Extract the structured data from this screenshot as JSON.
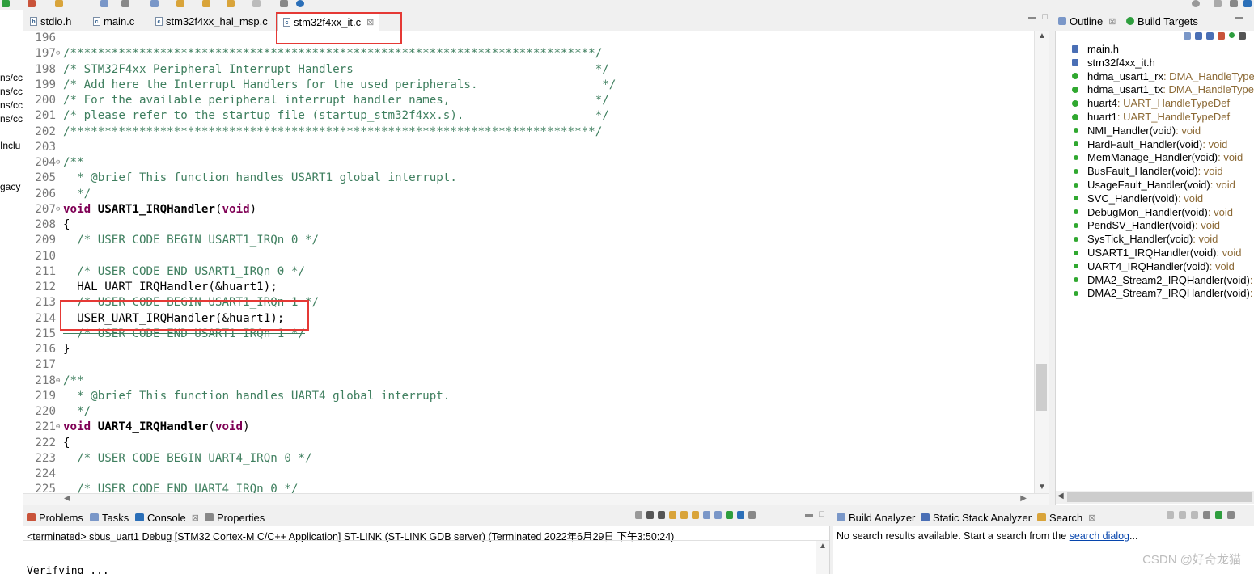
{
  "editor": {
    "tabs": [
      {
        "label": "stdio.h",
        "icon": "header-file-icon",
        "active": false
      },
      {
        "label": "main.c",
        "icon": "c-file-icon",
        "active": false
      },
      {
        "label": "stm32f4xx_hal_msp.c",
        "icon": "c-file-icon",
        "active": false
      },
      {
        "label": "stm32f4xx_it.c",
        "icon": "c-file-icon",
        "active": true
      }
    ],
    "close_glyph": "⊠",
    "lines": [
      {
        "num": "196",
        "segments": []
      },
      {
        "num": "197",
        "fold": true,
        "segments": [
          {
            "t": "/****************************************************************************/",
            "c": "com"
          }
        ]
      },
      {
        "num": "198",
        "segments": [
          {
            "t": "/* STM32F4xx Peripheral Interrupt Handlers                                   */",
            "c": "com"
          }
        ]
      },
      {
        "num": "199",
        "segments": [
          {
            "t": "/* Add here the Interrupt Handlers for the used peripherals.                  */",
            "c": "com"
          }
        ]
      },
      {
        "num": "200",
        "segments": [
          {
            "t": "/* For the available peripheral interrupt handler names,                     */",
            "c": "com"
          }
        ]
      },
      {
        "num": "201",
        "segments": [
          {
            "t": "/* please refer to the startup file (startup_stm32f4xx.s).                   */",
            "c": "com"
          }
        ]
      },
      {
        "num": "202",
        "segments": [
          {
            "t": "/****************************************************************************/",
            "c": "com"
          }
        ]
      },
      {
        "num": "203",
        "segments": []
      },
      {
        "num": "204",
        "fold": true,
        "segments": [
          {
            "t": "/**",
            "c": "com"
          }
        ]
      },
      {
        "num": "205",
        "segments": [
          {
            "t": "  * @brief This function handles USART1 global interrupt.",
            "c": "com"
          }
        ]
      },
      {
        "num": "206",
        "segments": [
          {
            "t": "  */",
            "c": "com"
          }
        ]
      },
      {
        "num": "207",
        "fold": true,
        "segments": [
          {
            "t": "void",
            "c": "kw"
          },
          {
            "t": " ",
            "c": "txt"
          },
          {
            "t": "USART1_IRQHandler",
            "c": "fn"
          },
          {
            "t": "(",
            "c": "txt"
          },
          {
            "t": "void",
            "c": "kw"
          },
          {
            "t": ")",
            "c": "txt"
          }
        ]
      },
      {
        "num": "208",
        "segments": [
          {
            "t": "{",
            "c": "txt"
          }
        ]
      },
      {
        "num": "209",
        "segments": [
          {
            "t": "  /* USER CODE BEGIN USART1_IRQn 0 */",
            "c": "com"
          }
        ]
      },
      {
        "num": "210",
        "segments": []
      },
      {
        "num": "211",
        "segments": [
          {
            "t": "  /* USER CODE END USART1_IRQn 0 */",
            "c": "com"
          }
        ]
      },
      {
        "num": "212",
        "segments": [
          {
            "t": "  HAL_UART_IRQHandler(&huart1);",
            "c": "txt"
          }
        ]
      },
      {
        "num": "213",
        "segments": [
          {
            "t": "  /* USER CODE BEGIN USART1_IRQn 1 */",
            "c": "strike"
          }
        ]
      },
      {
        "num": "214",
        "segments": [
          {
            "t": "  USER_UART_IRQHandler(&huart1);",
            "c": "txt"
          }
        ]
      },
      {
        "num": "215",
        "segments": [
          {
            "t": "  /* USER CODE END USART1_IRQn 1 */",
            "c": "strike"
          }
        ]
      },
      {
        "num": "216",
        "segments": [
          {
            "t": "}",
            "c": "txt"
          }
        ]
      },
      {
        "num": "217",
        "segments": []
      },
      {
        "num": "218",
        "fold": true,
        "segments": [
          {
            "t": "/**",
            "c": "com"
          }
        ]
      },
      {
        "num": "219",
        "segments": [
          {
            "t": "  * @brief This function handles UART4 global interrupt.",
            "c": "com"
          }
        ]
      },
      {
        "num": "220",
        "segments": [
          {
            "t": "  */",
            "c": "com"
          }
        ]
      },
      {
        "num": "221",
        "fold": true,
        "segments": [
          {
            "t": "void",
            "c": "kw"
          },
          {
            "t": " ",
            "c": "txt"
          },
          {
            "t": "UART4_IRQHandler",
            "c": "fn"
          },
          {
            "t": "(",
            "c": "txt"
          },
          {
            "t": "void",
            "c": "kw"
          },
          {
            "t": ")",
            "c": "txt"
          }
        ]
      },
      {
        "num": "222",
        "segments": [
          {
            "t": "{",
            "c": "txt"
          }
        ]
      },
      {
        "num": "223",
        "segments": [
          {
            "t": "  /* USER CODE BEGIN UART4_IRQn 0 */",
            "c": "com"
          }
        ]
      },
      {
        "num": "224",
        "segments": []
      },
      {
        "num": "225",
        "segments": [
          {
            "t": "  /* USER CODE END UART4_IRQn 0 */",
            "c": "com"
          }
        ]
      }
    ]
  },
  "left_fragments": [
    "ns/cc",
    "ns/cc",
    "ns/cc",
    "ns/cc",
    "Inclu",
    "gacy"
  ],
  "outline": {
    "tabs": [
      {
        "label": "Outline",
        "icon": "outline-icon"
      },
      {
        "label": "Build Targets",
        "icon": "build-targets-icon"
      }
    ],
    "items": [
      {
        "name": "main.h",
        "type": "",
        "kind": "include"
      },
      {
        "name": "stm32f4xx_it.h",
        "type": "",
        "kind": "include"
      },
      {
        "name": "hdma_usart1_rx",
        "type": " : DMA_HandleTypeDef",
        "kind": "variable"
      },
      {
        "name": "hdma_usart1_tx",
        "type": " : DMA_HandleTypeDef",
        "kind": "variable"
      },
      {
        "name": "huart4",
        "type": " : UART_HandleTypeDef",
        "kind": "variable"
      },
      {
        "name": "huart1",
        "type": " : UART_HandleTypeDef",
        "kind": "variable"
      },
      {
        "name": "NMI_Handler(void)",
        "type": " : void",
        "kind": "function"
      },
      {
        "name": "HardFault_Handler(void)",
        "type": " : void",
        "kind": "function"
      },
      {
        "name": "MemManage_Handler(void)",
        "type": " : void",
        "kind": "function"
      },
      {
        "name": "BusFault_Handler(void)",
        "type": " : void",
        "kind": "function"
      },
      {
        "name": "UsageFault_Handler(void)",
        "type": " : void",
        "kind": "function"
      },
      {
        "name": "SVC_Handler(void)",
        "type": " : void",
        "kind": "function"
      },
      {
        "name": "DebugMon_Handler(void)",
        "type": " : void",
        "kind": "function"
      },
      {
        "name": "PendSV_Handler(void)",
        "type": " : void",
        "kind": "function"
      },
      {
        "name": "SysTick_Handler(void)",
        "type": " : void",
        "kind": "function"
      },
      {
        "name": "USART1_IRQHandler(void)",
        "type": " : void",
        "kind": "function"
      },
      {
        "name": "UART4_IRQHandler(void)",
        "type": " : void",
        "kind": "function"
      },
      {
        "name": "DMA2_Stream2_IRQHandler(void)",
        "type": " : void",
        "kind": "function"
      },
      {
        "name": "DMA2_Stream7_IRQHandler(void)",
        "type": " : void",
        "kind": "function"
      }
    ]
  },
  "console": {
    "tabs": [
      {
        "label": "Problems",
        "icon": "problems-icon"
      },
      {
        "label": "Tasks",
        "icon": "tasks-icon"
      },
      {
        "label": "Console",
        "icon": "console-icon",
        "active": true
      },
      {
        "label": "Properties",
        "icon": "properties-icon"
      }
    ],
    "status": "<terminated> sbus_uart1 Debug [STM32 Cortex-M C/C++ Application] ST-LINK (ST-LINK GDB server) (Terminated 2022年6月29日 下午3:50:24)",
    "last_line": "Verifying ..."
  },
  "search": {
    "tabs": [
      {
        "label": "Build Analyzer",
        "icon": "build-analyzer-icon"
      },
      {
        "label": "Static Stack Analyzer",
        "icon": "stack-analyzer-icon"
      },
      {
        "label": "Search",
        "icon": "search-icon",
        "active": true
      }
    ],
    "message": "No search results available. Start a search from the ",
    "link": "search dialog",
    "suffix": "..."
  },
  "watermark": "CSDN @好奇龙猫",
  "colors": {
    "comment": "#3f7f5f",
    "keyword": "#7f0055",
    "highlight_box": "#e53935",
    "outline_type": "#8c6a36"
  }
}
